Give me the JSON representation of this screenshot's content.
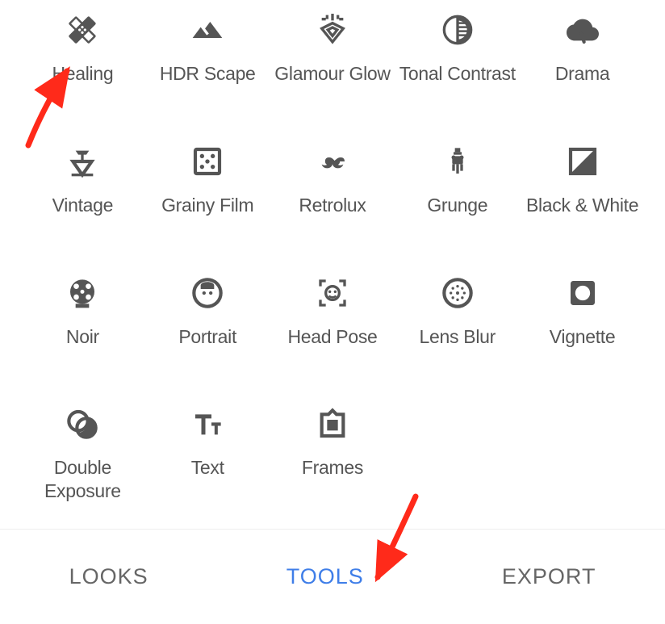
{
  "tools": [
    {
      "id": "healing",
      "label": "Healing"
    },
    {
      "id": "hdr-scape",
      "label": "HDR Scape"
    },
    {
      "id": "glamour-glow",
      "label": "Glamour Glow"
    },
    {
      "id": "tonal-contrast",
      "label": "Tonal Contrast"
    },
    {
      "id": "drama",
      "label": "Drama"
    },
    {
      "id": "vintage",
      "label": "Vintage"
    },
    {
      "id": "grainy-film",
      "label": "Grainy Film"
    },
    {
      "id": "retrolux",
      "label": "Retrolux"
    },
    {
      "id": "grunge",
      "label": "Grunge"
    },
    {
      "id": "black-white",
      "label": "Black & White"
    },
    {
      "id": "noir",
      "label": "Noir"
    },
    {
      "id": "portrait",
      "label": "Portrait"
    },
    {
      "id": "head-pose",
      "label": "Head Pose"
    },
    {
      "id": "lens-blur",
      "label": "Lens Blur"
    },
    {
      "id": "vignette",
      "label": "Vignette"
    },
    {
      "id": "double-exposure",
      "label": "Double Exposure"
    },
    {
      "id": "text",
      "label": "Text"
    },
    {
      "id": "frames",
      "label": "Frames"
    }
  ],
  "tabs": {
    "looks": "LOOKS",
    "tools": "TOOLS",
    "export": "EXPORT",
    "active": "tools"
  },
  "annotations": {
    "arrow1_target": "healing",
    "arrow2_target": "tools-tab"
  }
}
